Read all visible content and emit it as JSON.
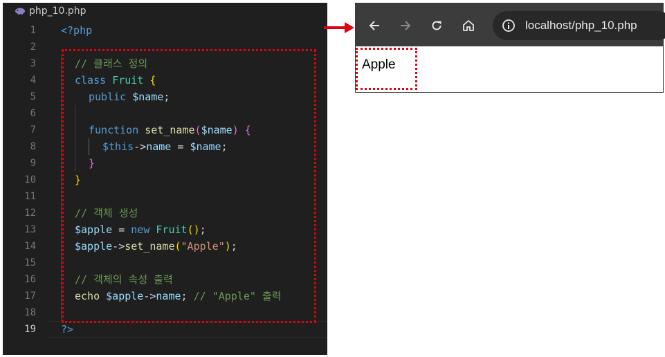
{
  "editor": {
    "filename": "php_10.php",
    "active_line": 19,
    "lines": [
      {
        "n": "1",
        "indent": 0,
        "tokens": [
          {
            "t": "<?php",
            "c": "#569cd6"
          }
        ]
      },
      {
        "n": "2",
        "indent": 0,
        "tokens": []
      },
      {
        "n": "3",
        "indent": 1,
        "tokens": [
          {
            "t": "// 클래스 정의",
            "c": "#6a9955"
          }
        ]
      },
      {
        "n": "4",
        "indent": 1,
        "tokens": [
          {
            "t": "class ",
            "c": "#569cd6"
          },
          {
            "t": "Fruit",
            "c": "#4ec9b0"
          },
          {
            "t": " ",
            "c": "#d4d4d4"
          },
          {
            "t": "{",
            "c": "#ffd700"
          }
        ]
      },
      {
        "n": "5",
        "indent": 2,
        "tokens": [
          {
            "t": "public ",
            "c": "#569cd6"
          },
          {
            "t": "$name",
            "c": "#9cdcfe"
          },
          {
            "t": ";",
            "c": "#d4d4d4"
          }
        ]
      },
      {
        "n": "6",
        "indent": 0,
        "tokens": []
      },
      {
        "n": "7",
        "indent": 2,
        "tokens": [
          {
            "t": "function ",
            "c": "#569cd6"
          },
          {
            "t": "set_name",
            "c": "#dcdcaa"
          },
          {
            "t": "(",
            "c": "#da70d6"
          },
          {
            "t": "$name",
            "c": "#9cdcfe"
          },
          {
            "t": ") ",
            "c": "#da70d6"
          },
          {
            "t": "{",
            "c": "#da70d6"
          }
        ]
      },
      {
        "n": "8",
        "indent": 3,
        "tokens": [
          {
            "t": "$this",
            "c": "#569cd6"
          },
          {
            "t": "->",
            "c": "#d4d4d4"
          },
          {
            "t": "name",
            "c": "#9cdcfe"
          },
          {
            "t": " = ",
            "c": "#d4d4d4"
          },
          {
            "t": "$name",
            "c": "#9cdcfe"
          },
          {
            "t": ";",
            "c": "#d4d4d4"
          }
        ]
      },
      {
        "n": "9",
        "indent": 2,
        "tokens": [
          {
            "t": "}",
            "c": "#da70d6"
          }
        ]
      },
      {
        "n": "10",
        "indent": 1,
        "tokens": [
          {
            "t": "}",
            "c": "#ffd700"
          }
        ]
      },
      {
        "n": "11",
        "indent": 0,
        "tokens": []
      },
      {
        "n": "12",
        "indent": 1,
        "tokens": [
          {
            "t": "// 객체 생성",
            "c": "#6a9955"
          }
        ]
      },
      {
        "n": "13",
        "indent": 1,
        "tokens": [
          {
            "t": "$apple",
            "c": "#9cdcfe"
          },
          {
            "t": " = ",
            "c": "#d4d4d4"
          },
          {
            "t": "new ",
            "c": "#569cd6"
          },
          {
            "t": "Fruit",
            "c": "#4ec9b0"
          },
          {
            "t": "()",
            "c": "#ffd700"
          },
          {
            "t": ";",
            "c": "#d4d4d4"
          }
        ]
      },
      {
        "n": "14",
        "indent": 1,
        "tokens": [
          {
            "t": "$apple",
            "c": "#9cdcfe"
          },
          {
            "t": "->",
            "c": "#d4d4d4"
          },
          {
            "t": "set_name",
            "c": "#dcdcaa"
          },
          {
            "t": "(",
            "c": "#ffd700"
          },
          {
            "t": "\"Apple\"",
            "c": "#ce9178"
          },
          {
            "t": ")",
            "c": "#ffd700"
          },
          {
            "t": ";",
            "c": "#d4d4d4"
          }
        ]
      },
      {
        "n": "15",
        "indent": 0,
        "tokens": []
      },
      {
        "n": "16",
        "indent": 1,
        "tokens": [
          {
            "t": "// 객체의 속성 출력",
            "c": "#6a9955"
          }
        ]
      },
      {
        "n": "17",
        "indent": 1,
        "tokens": [
          {
            "t": "echo ",
            "c": "#dcdcaa"
          },
          {
            "t": "$apple",
            "c": "#9cdcfe"
          },
          {
            "t": "->",
            "c": "#d4d4d4"
          },
          {
            "t": "name",
            "c": "#9cdcfe"
          },
          {
            "t": "; ",
            "c": "#d4d4d4"
          },
          {
            "t": "// \"Apple\" 출력",
            "c": "#6a9955"
          }
        ]
      },
      {
        "n": "18",
        "indent": 0,
        "tokens": []
      },
      {
        "n": "19",
        "indent": 0,
        "tokens": [
          {
            "t": "?>",
            "c": "#569cd6"
          }
        ]
      }
    ]
  },
  "browser": {
    "url": "localhost/php_10.php",
    "output": "Apple",
    "icons": [
      "back-arrow-icon",
      "forward-arrow-icon",
      "reload-icon",
      "home-icon",
      "info-icon"
    ]
  },
  "colors": {
    "highlight": "#e0000f",
    "editor_bg": "#1f1f1f",
    "toolbar_bg": "#3c3c3c"
  }
}
